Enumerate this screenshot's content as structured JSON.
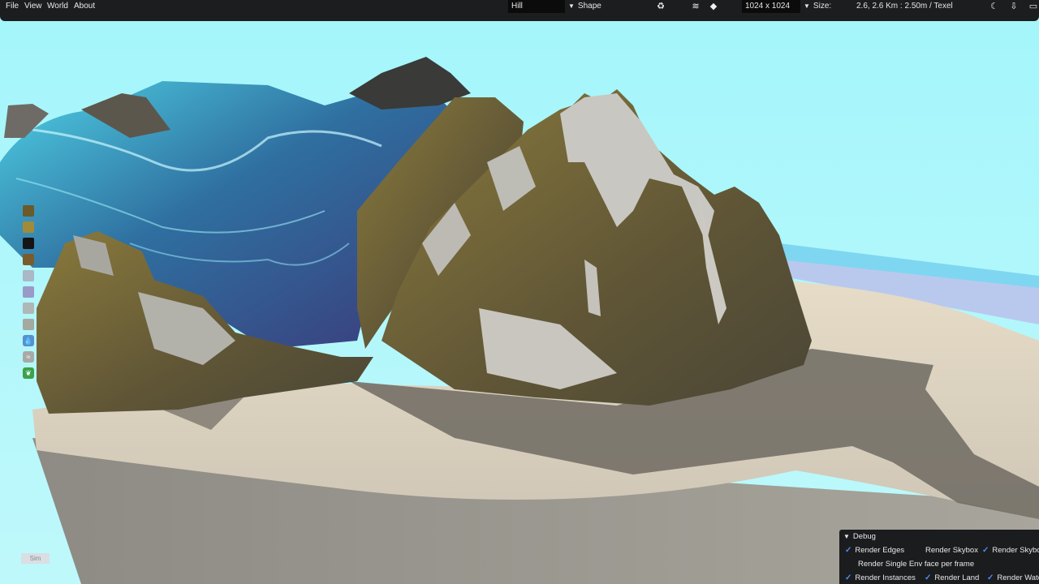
{
  "menu": [
    "File",
    "View",
    "World",
    "About"
  ],
  "toolbar": {
    "brush_field": "Hill",
    "shape_label": "Shape",
    "resolution": "1024 x 1024",
    "size_label": "Size:",
    "size_value": "2.6, 2.6 Km  :  2.50m / Texel"
  },
  "palette": {
    "swatches": [
      "#6b5a2a",
      "#a08b3a",
      "#151515",
      "#7a5c2c",
      "#aab8c7",
      "#9a9ac6",
      "#b0b7b7",
      "#a4aaa0"
    ],
    "tools": [
      "water-drop-icon",
      "wind-icon",
      "plant-icon"
    ]
  },
  "sim_label": "Sim",
  "debug": {
    "title": "Debug",
    "options": [
      {
        "label": "Render Edges",
        "checked": true
      },
      {
        "label": "Render Skybox",
        "checked": false
      },
      {
        "label": "Render Skybox",
        "checked": true
      },
      {
        "label": "Render Single Env face per frame",
        "checked": false
      },
      {
        "label": "Render Instances",
        "checked": true
      },
      {
        "label": "Render Land",
        "checked": true
      },
      {
        "label": "Render Water",
        "checked": true
      }
    ]
  },
  "colors": {
    "sky": "#a8f4fa",
    "panel": "#1b1c1e",
    "accent": "#4d8df6"
  }
}
